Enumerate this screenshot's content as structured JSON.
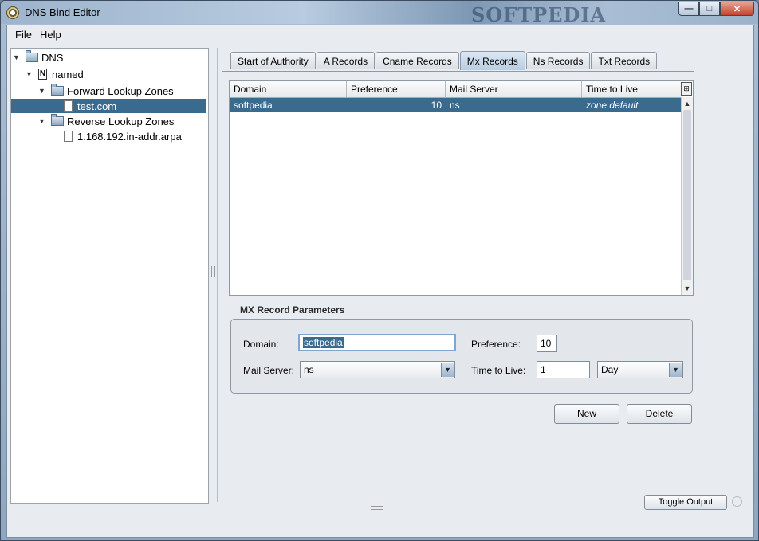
{
  "window": {
    "title": "DNS Bind Editor",
    "watermark": "SOFTPEDIA",
    "controls": {
      "minimize": "—",
      "maximize": "□",
      "close": "✕"
    }
  },
  "menu": {
    "file": "File",
    "help": "Help"
  },
  "tree": {
    "root": "DNS",
    "named": "named",
    "named_icon": "N",
    "forward": "Forward Lookup Zones",
    "forward_child": "test.com",
    "reverse": "Reverse Lookup Zones",
    "reverse_child": "1.168.192.in-addr.arpa"
  },
  "tabs": [
    "Start of Authority",
    "A Records",
    "Cname Records",
    "Mx Records",
    "Ns Records",
    "Txt Records"
  ],
  "active_tab": "Mx Records",
  "table": {
    "columns": [
      "Domain",
      "Preference",
      "Mail Server",
      "Time to Live"
    ],
    "rows": [
      {
        "domain": "softpedia",
        "preference": "10",
        "mail_server": "ns",
        "ttl": "zone default"
      }
    ]
  },
  "params": {
    "title": "MX Record Parameters",
    "domain_label": "Domain:",
    "domain_value": "softpedia",
    "preference_label": "Preference:",
    "preference_value": "10",
    "mail_server_label": "Mail Server:",
    "mail_server_value": "ns",
    "ttl_label": "Time to Live:",
    "ttl_value": "1",
    "ttl_unit": "Day"
  },
  "buttons": {
    "new": "New",
    "delete": "Delete",
    "toggle_output": "Toggle Output"
  },
  "colors": {
    "selection": "#3b6a8f",
    "titlebar": "#a9bdd3",
    "panel": "#e8ebef"
  }
}
